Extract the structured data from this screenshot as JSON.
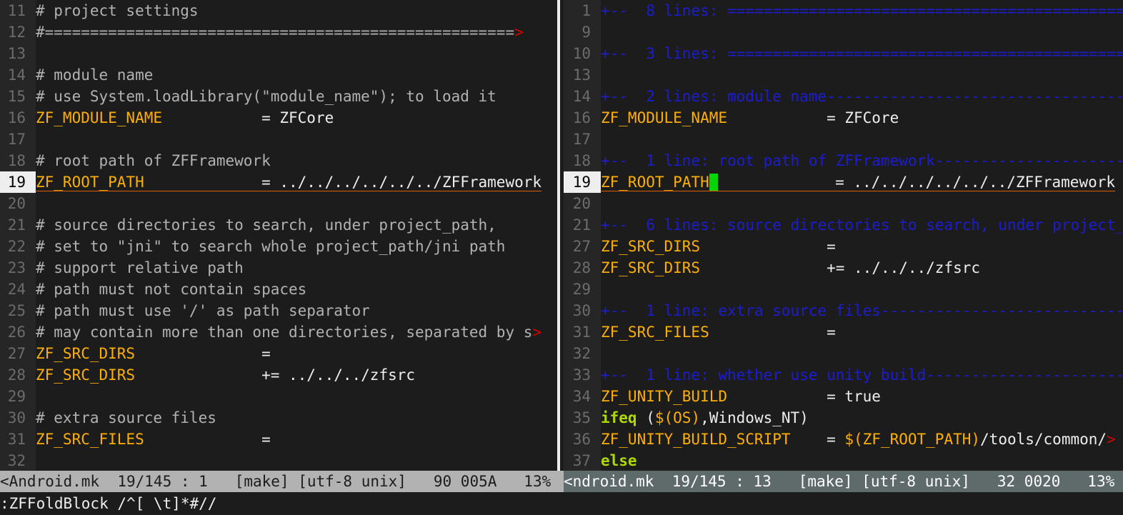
{
  "colors": {
    "comment": "#b2b2b2",
    "variable": "#ffaf00",
    "fold": "#1c1cd0",
    "keyword": "#afd700",
    "cursor": "#00d700",
    "truncation": "#d70000"
  },
  "left_pane": {
    "lines": [
      {
        "n": "11",
        "segs": [
          {
            "c": "comment",
            "t": "# project settings"
          }
        ]
      },
      {
        "n": "12",
        "segs": [
          {
            "c": "comment",
            "t": "#===================================================="
          }
        ],
        "trunc": ">"
      },
      {
        "n": "13",
        "segs": []
      },
      {
        "n": "14",
        "segs": [
          {
            "c": "comment",
            "t": "# module name"
          }
        ]
      },
      {
        "n": "15",
        "segs": [
          {
            "c": "comment",
            "t": "# use System.loadLibrary(\"module_name\"); to load it"
          }
        ]
      },
      {
        "n": "16",
        "segs": [
          {
            "c": "var",
            "t": "ZF_MODULE_NAME"
          },
          {
            "c": "text",
            "t": "           = ZFCore"
          }
        ]
      },
      {
        "n": "17",
        "segs": []
      },
      {
        "n": "18",
        "segs": [
          {
            "c": "comment",
            "t": "# root path of ZFFramework"
          }
        ]
      },
      {
        "n": "19",
        "current": true,
        "segs": [
          {
            "c": "var",
            "t": "ZF_ROOT_PATH"
          },
          {
            "c": "text",
            "t": "             = ../../../../../../ZFFramework"
          }
        ]
      },
      {
        "n": "20",
        "segs": []
      },
      {
        "n": "21",
        "segs": [
          {
            "c": "comment",
            "t": "# source directories to search, under project_path,"
          }
        ]
      },
      {
        "n": "22",
        "segs": [
          {
            "c": "comment",
            "t": "# set to \"jni\" to search whole project_path/jni path"
          }
        ]
      },
      {
        "n": "23",
        "segs": [
          {
            "c": "comment",
            "t": "# support relative path"
          }
        ]
      },
      {
        "n": "24",
        "segs": [
          {
            "c": "comment",
            "t": "# path must not contain spaces"
          }
        ]
      },
      {
        "n": "25",
        "segs": [
          {
            "c": "comment",
            "t": "# path must use '/' as path separator"
          }
        ]
      },
      {
        "n": "26",
        "segs": [
          {
            "c": "comment",
            "t": "# may contain more than one directories, separated by s"
          }
        ],
        "trunc": ">"
      },
      {
        "n": "27",
        "segs": [
          {
            "c": "var",
            "t": "ZF_SRC_DIRS"
          },
          {
            "c": "text",
            "t": "              ="
          }
        ]
      },
      {
        "n": "28",
        "segs": [
          {
            "c": "var",
            "t": "ZF_SRC_DIRS"
          },
          {
            "c": "text",
            "t": "              += ../../../zfsrc"
          }
        ]
      },
      {
        "n": "29",
        "segs": []
      },
      {
        "n": "30",
        "segs": [
          {
            "c": "comment",
            "t": "# extra source files"
          }
        ]
      },
      {
        "n": "31",
        "segs": [
          {
            "c": "var",
            "t": "ZF_SRC_FILES"
          },
          {
            "c": "text",
            "t": "             ="
          }
        ]
      },
      {
        "n": "32",
        "segs": []
      }
    ]
  },
  "right_pane": {
    "lines": [
      {
        "n": "1",
        "segs": [
          {
            "c": "fold",
            "t": "+--  8 lines: ======================================================="
          }
        ]
      },
      {
        "n": "9",
        "segs": []
      },
      {
        "n": "10",
        "segs": [
          {
            "c": "fold",
            "t": "+--  3 lines: ======================================================="
          }
        ]
      },
      {
        "n": "13",
        "segs": []
      },
      {
        "n": "14",
        "segs": [
          {
            "c": "fold",
            "t": "+--  2 lines: module name-----------------------------------------"
          }
        ]
      },
      {
        "n": "16",
        "segs": [
          {
            "c": "var",
            "t": "ZF_MODULE_NAME"
          },
          {
            "c": "text",
            "t": "           = ZFCore"
          }
        ]
      },
      {
        "n": "17",
        "segs": []
      },
      {
        "n": "18",
        "segs": [
          {
            "c": "fold",
            "t": "+--  1 line: root path of ZFFramework---------------------------"
          }
        ]
      },
      {
        "n": "19",
        "current": true,
        "cursor_after": 0,
        "segs": [
          {
            "c": "var",
            "t": "ZF_ROOT_PATH"
          },
          {
            "c": "text",
            "t": "             = ../../../../../../ZFFramework"
          }
        ]
      },
      {
        "n": "20",
        "segs": []
      },
      {
        "n": "21",
        "segs": [
          {
            "c": "fold",
            "t": "+--  6 lines: source directories to search, under project_path,"
          }
        ]
      },
      {
        "n": "27",
        "segs": [
          {
            "c": "var",
            "t": "ZF_SRC_DIRS"
          },
          {
            "c": "text",
            "t": "              ="
          }
        ]
      },
      {
        "n": "28",
        "segs": [
          {
            "c": "var",
            "t": "ZF_SRC_DIRS"
          },
          {
            "c": "text",
            "t": "              += ../../../zfsrc"
          }
        ]
      },
      {
        "n": "29",
        "segs": []
      },
      {
        "n": "30",
        "segs": [
          {
            "c": "fold",
            "t": "+--  1 line: extra source files--------------------------------"
          }
        ]
      },
      {
        "n": "31",
        "segs": [
          {
            "c": "var",
            "t": "ZF_SRC_FILES"
          },
          {
            "c": "text",
            "t": "             ="
          }
        ]
      },
      {
        "n": "32",
        "segs": []
      },
      {
        "n": "33",
        "segs": [
          {
            "c": "fold",
            "t": "+--  1 line: whether use unity build---------------------------"
          }
        ]
      },
      {
        "n": "34",
        "segs": [
          {
            "c": "var",
            "t": "ZF_UNITY_BUILD"
          },
          {
            "c": "text",
            "t": "           = true"
          }
        ]
      },
      {
        "n": "35",
        "segs": [
          {
            "c": "kw",
            "t": "ifeq"
          },
          {
            "c": "text",
            "t": " ("
          },
          {
            "c": "paren",
            "t": "$(OS)"
          },
          {
            "c": "text",
            "t": ",Windows_NT)"
          }
        ]
      },
      {
        "n": "36",
        "segs": [
          {
            "c": "var",
            "t": "ZF_UNITY_BUILD_SCRIPT"
          },
          {
            "c": "text",
            "t": "    = "
          },
          {
            "c": "paren",
            "t": "$(ZF_ROOT_PATH)"
          },
          {
            "c": "text",
            "t": "/tools/common/"
          }
        ],
        "trunc": ">"
      },
      {
        "n": "37",
        "segs": [
          {
            "c": "kw",
            "t": "else"
          }
        ]
      }
    ]
  },
  "status_left": "<Android.mk  19/145 : 1   [make] [utf-8 unix]   90 005A   13%",
  "status_right": "<ndroid.mk  19/145 : 13   [make] [utf-8 unix]   32 0020   13%",
  "cmdline": ":ZFFoldBlock /^[ \\t]*#//"
}
